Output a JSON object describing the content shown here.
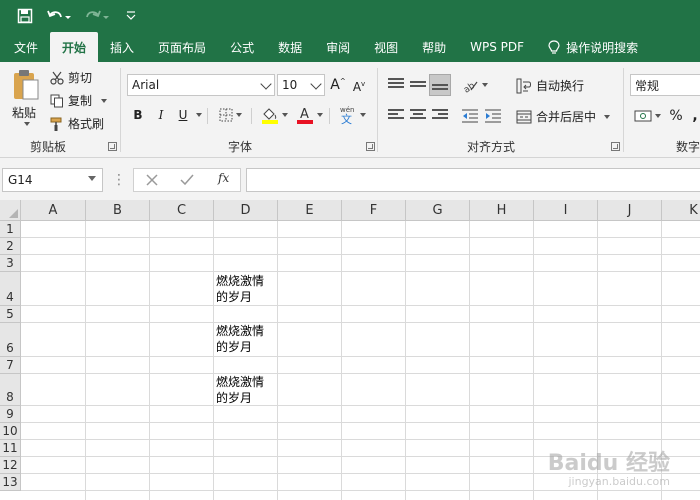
{
  "titlebar": {
    "bg": "#217346"
  },
  "tabs": [
    {
      "label": "文件",
      "active": false
    },
    {
      "label": "开始",
      "active": true
    },
    {
      "label": "插入",
      "active": false
    },
    {
      "label": "页面布局",
      "active": false
    },
    {
      "label": "公式",
      "active": false
    },
    {
      "label": "数据",
      "active": false
    },
    {
      "label": "审阅",
      "active": false
    },
    {
      "label": "视图",
      "active": false
    },
    {
      "label": "帮助",
      "active": false
    },
    {
      "label": "WPS PDF",
      "active": false
    },
    {
      "label": "操作说明搜索",
      "active": false
    }
  ],
  "clipboard": {
    "paste": "粘贴",
    "cut": "剪切",
    "copy": "复制",
    "format_painter": "格式刷",
    "group": "剪贴板"
  },
  "font": {
    "name": "Arial",
    "size": "10",
    "group": "字体",
    "bold": "B",
    "italic": "I",
    "underline": "U",
    "font_color": "#e81123",
    "highlight_color": "#ffff00"
  },
  "alignment": {
    "wrap": "自动换行",
    "merge": "合并后居中",
    "group": "对齐方式"
  },
  "number": {
    "format": "常规",
    "group": "数字",
    "percent": "%"
  },
  "formula_bar": {
    "cell_ref": "G14",
    "fx": "fx"
  },
  "grid": {
    "columns": [
      "A",
      "B",
      "C",
      "D",
      "E",
      "F",
      "G",
      "H",
      "I",
      "J",
      "K"
    ],
    "rows": [
      "1",
      "2",
      "3",
      "4",
      "5",
      "6",
      "7",
      "8",
      "9",
      "10",
      "11",
      "12",
      "13"
    ],
    "cells": {
      "D4": "燃烧激情\n的岁月",
      "D6": "燃烧激情\n的岁月",
      "D8": "燃烧激情\n的岁月"
    }
  },
  "watermark": {
    "main": "Baidu 经验",
    "sub": "jingyan.baidu.com"
  }
}
